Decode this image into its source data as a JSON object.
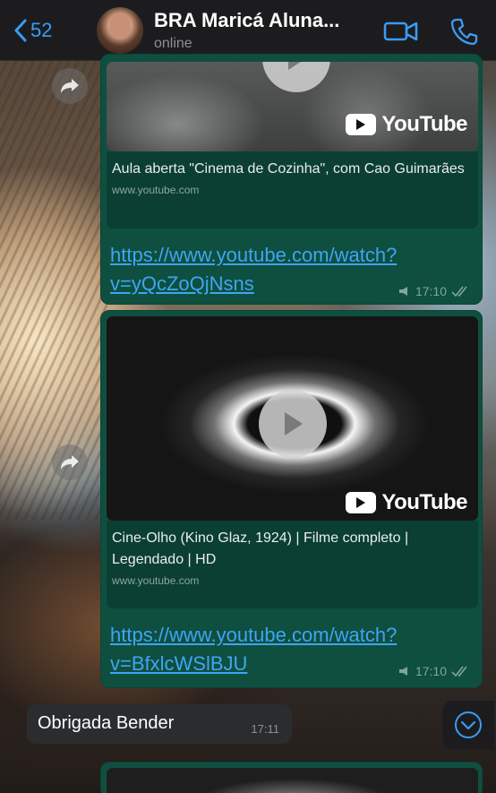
{
  "header": {
    "back_count": "52",
    "chat_title": "BRA Maricá Aluna...",
    "status": "online"
  },
  "messages": [
    {
      "preview_title": "Aula aberta \"Cinema de Cozinha\", com Cao Guimarães",
      "domain": "www.youtube.com",
      "url_line1": "https://www.youtube.com/watch?",
      "url_line2": "v=yQcZoQjNsns",
      "time": "17:10",
      "brand": "YouTube"
    },
    {
      "preview_title": "Cine-Olho (Kino Glaz, 1924) | Filme completo | Legendado | HD",
      "domain": "www.youtube.com",
      "url_line1": "https://www.youtube.com/watch?",
      "url_line2": "v=BfxlcWSlBJU",
      "time": "17:10",
      "brand": "YouTube"
    }
  ],
  "incoming": {
    "text": "Obrigada Bender",
    "time": "17:11"
  },
  "colors": {
    "accent": "#3b9cf5",
    "bubble": "#0f4f3f",
    "link": "#3ea5f4"
  }
}
